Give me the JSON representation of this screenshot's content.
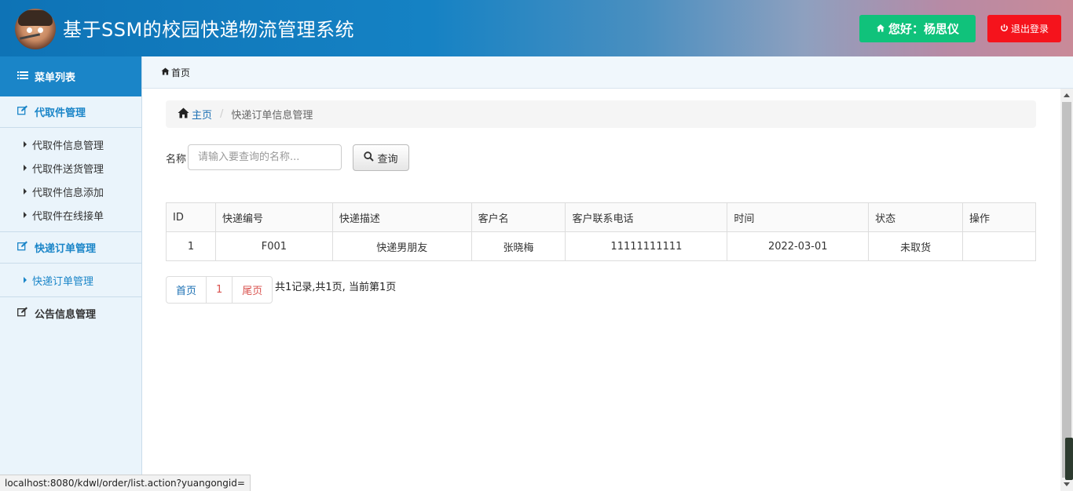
{
  "header": {
    "title": "基于SSM的校园快递物流管理系统",
    "greeting": "您好：杨思仪",
    "logout_label": "退出登录"
  },
  "sidebar": {
    "heading": "菜单列表",
    "groups": [
      {
        "label": "代取件管理",
        "items": [
          {
            "label": "代取件信息管理"
          },
          {
            "label": "代取件送货管理"
          },
          {
            "label": "代取件信息添加"
          },
          {
            "label": "代取件在线接单"
          }
        ]
      },
      {
        "label": "快递订单管理",
        "items": [
          {
            "label": "快递订单管理"
          }
        ]
      },
      {
        "label": "公告信息管理",
        "items": []
      }
    ]
  },
  "tabbar": {
    "home_tab": "首页"
  },
  "breadcrumb": {
    "home": "主页",
    "current": "快递订单信息管理"
  },
  "search": {
    "label": "名称",
    "placeholder": "请输入要查询的名称...",
    "value": "",
    "button_label": "查询"
  },
  "table": {
    "headers": [
      "ID",
      "快递编号",
      "快递描述",
      "客户名",
      "客户联系电话",
      "时间",
      "状态",
      "操作"
    ],
    "rows": [
      [
        "1",
        "F001",
        "快递男朋友",
        "张晓梅",
        "11111111111",
        "2022-03-01",
        "未取货",
        ""
      ]
    ]
  },
  "pager": {
    "first": "首页",
    "current": "1",
    "last": "尾页",
    "info": "共1记录,共1页, 当前第1页"
  },
  "status_bar": {
    "url": "localhost:8080/kdwl/order/list.action?yuangongid="
  },
  "colors": {
    "header_blue": "#0e73b6",
    "greet_green": "#10c27b",
    "logout_red": "#f5131c",
    "sidebar_bg": "#eaf4fb",
    "accent_blue": "#1a85c8"
  }
}
